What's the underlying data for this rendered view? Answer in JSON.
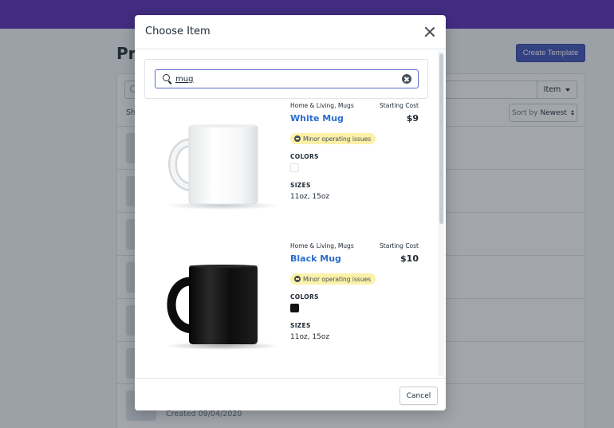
{
  "background": {
    "title": "Pro",
    "create_button": "Create Template",
    "item_filter": "Item",
    "show_label": "Sh",
    "sort_label": "Sort by",
    "sort_value": "Newest",
    "last_row_created": "Created 09/04/2020"
  },
  "modal": {
    "title": "Choose Item",
    "search_value": "mug",
    "cancel_label": "Cancel",
    "products": [
      {
        "category": "Home & Living, Mugs",
        "starting_cost_label": "Starting Cost",
        "name": "White Mug",
        "price": "$9",
        "status": "Minor operating issues",
        "colors_label": "COLORS",
        "color": "#ffffff",
        "sizes_label": "SIZES",
        "sizes": "11oz, 15oz"
      },
      {
        "category": "Home & Living, Mugs",
        "starting_cost_label": "Starting Cost",
        "name": "Black Mug",
        "price": "$10",
        "status": "Minor operating issues",
        "colors_label": "COLORS",
        "color": "#111111",
        "sizes_label": "SIZES",
        "sizes": "11oz, 15oz"
      }
    ]
  },
  "colors": {
    "topbar": "#5c2eb8",
    "primary_button": "#4353b8",
    "link": "#2c6ecb",
    "warning_badge": "#fcf1a8"
  }
}
